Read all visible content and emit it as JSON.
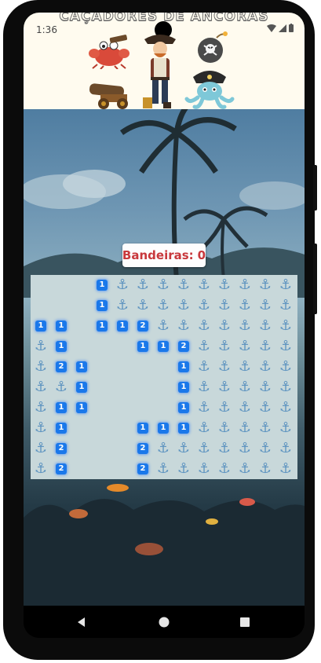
{
  "status_bar": {
    "time": "1:36"
  },
  "app": {
    "title": "CAÇADORES DE ÂNCORAS"
  },
  "game": {
    "flags_label": "Bandeiras:",
    "flags_count": "0",
    "board": [
      [
        "",
        "",
        "",
        "1",
        "A",
        "A",
        "A",
        "A",
        "A",
        "A",
        "A",
        "A",
        "A"
      ],
      [
        "",
        "",
        "",
        "1",
        "A",
        "A",
        "A",
        "A",
        "A",
        "A",
        "A",
        "A",
        "A"
      ],
      [
        "1",
        "1",
        "",
        "1",
        "1",
        "2",
        "A",
        "A",
        "A",
        "A",
        "A",
        "A",
        "A"
      ],
      [
        "A",
        "1",
        "",
        "",
        "",
        "1",
        "1",
        "2",
        "A",
        "A",
        "A",
        "A",
        "A"
      ],
      [
        "A",
        "2",
        "1",
        "",
        "",
        "",
        "",
        "1",
        "A",
        "A",
        "A",
        "A",
        "A"
      ],
      [
        "A",
        "A",
        "1",
        "",
        "",
        "",
        "",
        "1",
        "A",
        "A",
        "A",
        "A",
        "A"
      ],
      [
        "A",
        "1",
        "1",
        "",
        "",
        "",
        "",
        "1",
        "A",
        "A",
        "A",
        "A",
        "A"
      ],
      [
        "A",
        "1",
        "",
        "",
        "",
        "1",
        "1",
        "1",
        "A",
        "A",
        "A",
        "A",
        "A"
      ],
      [
        "A",
        "2",
        "",
        "",
        "",
        "2",
        "A",
        "A",
        "A",
        "A",
        "A",
        "A",
        "A"
      ],
      [
        "A",
        "2",
        "",
        "",
        "",
        "2",
        "A",
        "A",
        "A",
        "A",
        "A",
        "A",
        "A"
      ]
    ]
  },
  "colors": {
    "number_tile": "#1a78ea",
    "anchor": "#5e94c0",
    "board_bg": "#c8d8da",
    "flags_text": "#c8383c",
    "header_bg": "#fffbef"
  }
}
